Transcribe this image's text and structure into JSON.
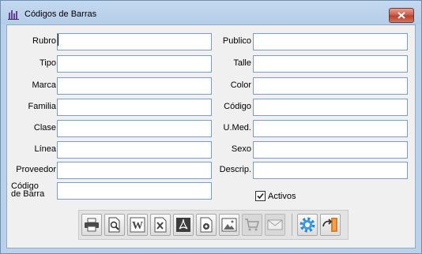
{
  "window": {
    "title": "Códigos de Barras"
  },
  "form": {
    "left": [
      {
        "name": "rubro",
        "label": "Rubro",
        "value": ""
      },
      {
        "name": "tipo",
        "label": "Tipo",
        "value": ""
      },
      {
        "name": "marca",
        "label": "Marca",
        "value": ""
      },
      {
        "name": "familia",
        "label": "Familia",
        "value": ""
      },
      {
        "name": "clase",
        "label": "Clase",
        "value": ""
      },
      {
        "name": "linea",
        "label": "Línea",
        "value": ""
      },
      {
        "name": "proveedor",
        "label": "Proveedor",
        "value": ""
      }
    ],
    "codigo_barra": {
      "label_line1": "Código",
      "label_line2": "de Barra",
      "value": ""
    },
    "right": [
      {
        "name": "publico",
        "label": "Publico",
        "value": ""
      },
      {
        "name": "talle",
        "label": "Talle",
        "value": ""
      },
      {
        "name": "color",
        "label": "Color",
        "value": ""
      },
      {
        "name": "codigo",
        "label": "Código",
        "value": ""
      },
      {
        "name": "umed",
        "label": "U.Med.",
        "value": ""
      },
      {
        "name": "sexo",
        "label": "Sexo",
        "value": ""
      },
      {
        "name": "descrip",
        "label": "Descrip.",
        "value": ""
      }
    ],
    "activos": {
      "label": "Activos",
      "checked": true
    }
  },
  "toolbar": {
    "buttons": [
      {
        "icon": "printer-icon",
        "enabled": true
      },
      {
        "icon": "print-preview-icon",
        "enabled": true
      },
      {
        "icon": "word-icon",
        "enabled": true
      },
      {
        "icon": "excel-icon",
        "enabled": true
      },
      {
        "icon": "pdf-icon",
        "enabled": true
      },
      {
        "icon": "open-office-icon",
        "enabled": true
      },
      {
        "icon": "image-icon",
        "enabled": true
      },
      {
        "icon": "cart-icon",
        "enabled": false
      },
      {
        "icon": "email-icon",
        "enabled": false
      },
      {
        "icon": "settings-gear-icon",
        "enabled": true
      },
      {
        "icon": "exit-door-icon",
        "enabled": true
      }
    ]
  },
  "colors": {
    "accent": "#3b8fd6",
    "field_border": "#7a9cc6",
    "frame": "#b9d1ea"
  }
}
